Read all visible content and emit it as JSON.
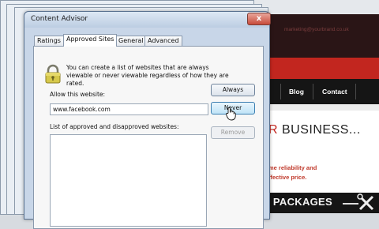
{
  "website": {
    "header_url": "marketing@yourbrand.co.uk",
    "nav": [
      "Blog",
      "Contact"
    ],
    "headline_prefix": "R",
    "headline_rest": " BUSINESS...",
    "body_lines": [
      "me reliability and",
      "ffective price."
    ],
    "footer_text": "E PACKAGES"
  },
  "dialog": {
    "title": "Content Advisor",
    "close_label": "x",
    "tabs": [
      {
        "label": "Ratings",
        "active": false
      },
      {
        "label": "Approved Sites",
        "active": true
      },
      {
        "label": "General",
        "active": false
      },
      {
        "label": "Advanced",
        "active": false
      }
    ],
    "info_text": "You can create a list of websites that are always viewable or never viewable regardless of how they are rated.",
    "allow_label": "Allow this website:",
    "website_value": "www.facebook.com",
    "list_label": "List of approved and disapproved websites:",
    "buttons": {
      "always": "Always",
      "never": "Never",
      "remove": "Remove"
    }
  },
  "colors": {
    "accent_red": "#c2261f",
    "dialog_frame": "#c8d6e8"
  }
}
